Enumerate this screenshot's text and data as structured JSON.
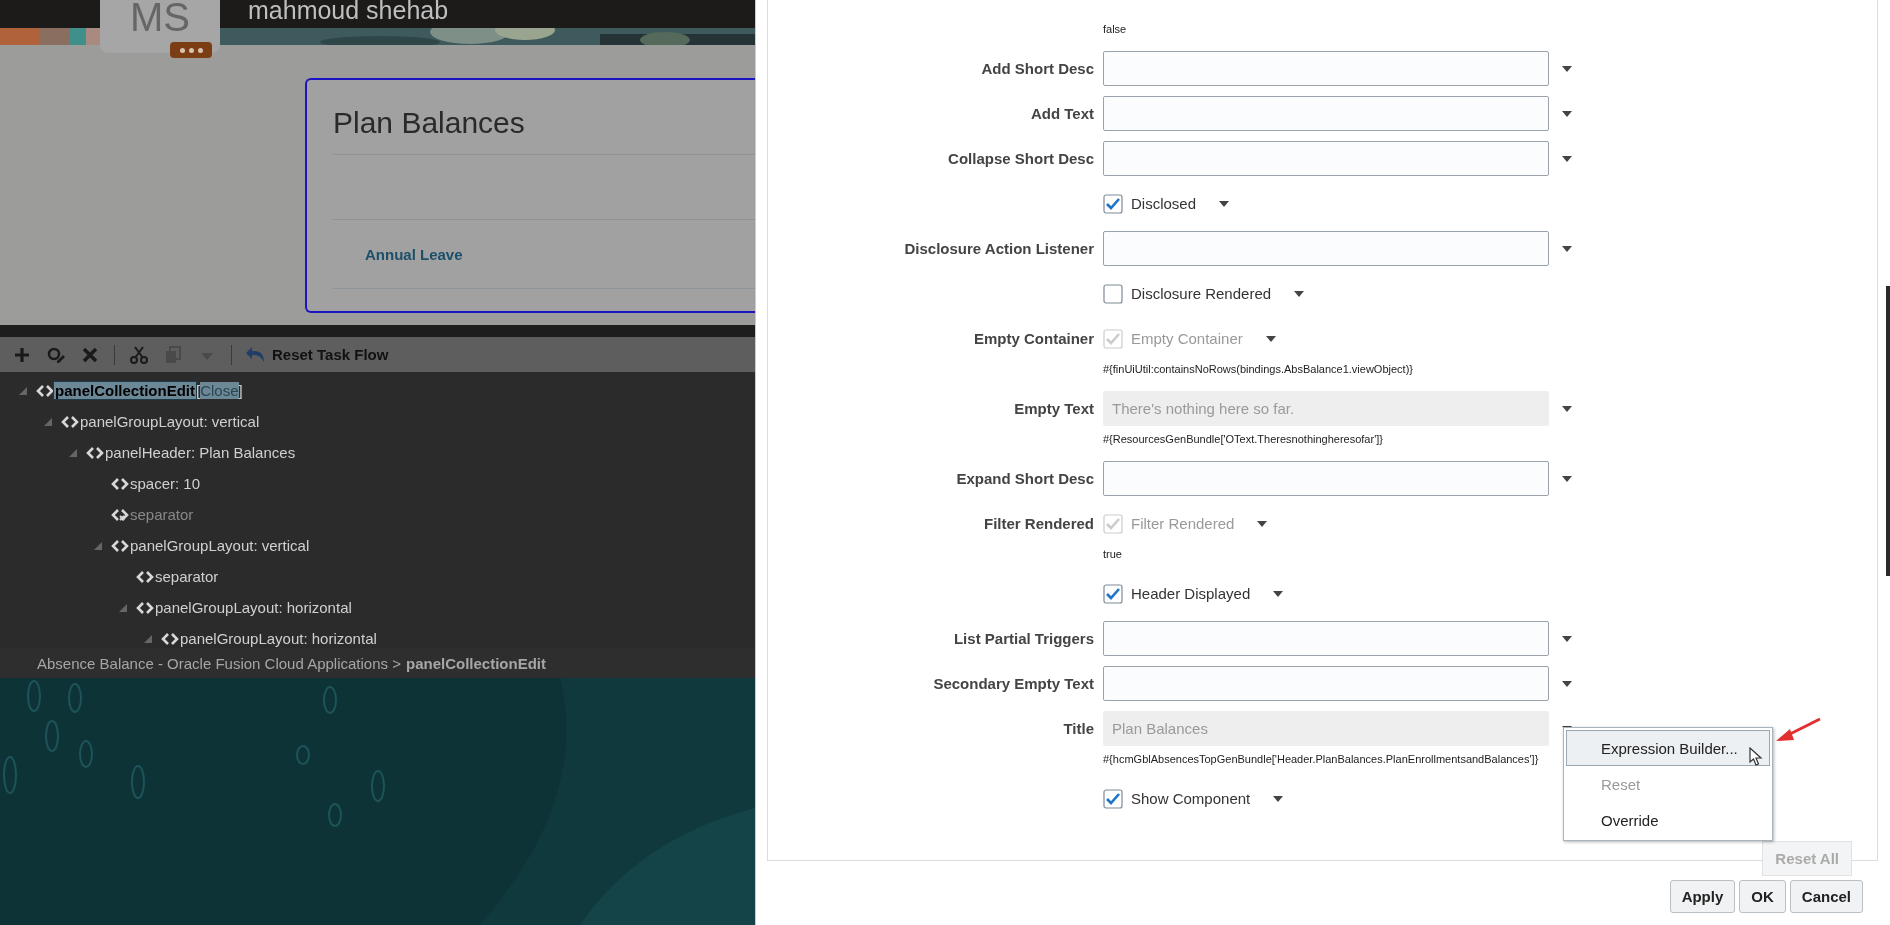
{
  "background_page": {
    "avatar_initials": "MS",
    "user_name": "mahmoud shehab",
    "card": {
      "title": "Plan Balances",
      "link": "Annual Leave"
    }
  },
  "toolbar": {
    "tools": [
      {
        "kind": "add",
        "disabled": false
      },
      {
        "kind": "edit",
        "disabled": false
      },
      {
        "kind": "delete",
        "disabled": false
      },
      {
        "kind": "cut",
        "disabled": false
      },
      {
        "kind": "copy",
        "disabled": true
      },
      {
        "kind": "dropdown",
        "disabled": true
      }
    ],
    "reset_button": "Reset Task Flow"
  },
  "tree": [
    {
      "label": "panelCollectionEdit",
      "action_open": "[",
      "action": "Close",
      "action_close": "]",
      "selected": true,
      "disabled": false,
      "expanded": true,
      "children": [
        {
          "label": "panelGroupLayout: vertical",
          "selected": false,
          "disabled": false,
          "expanded": true,
          "children": [
            {
              "label": "panelHeader: Plan Balances",
              "selected": false,
              "disabled": false,
              "expanded": true,
              "children": [
                {
                  "label": "spacer: 10",
                  "selected": false,
                  "disabled": false
                },
                {
                  "label": "separator",
                  "selected": false,
                  "disabled": true
                },
                {
                  "label": "panelGroupLayout: vertical",
                  "selected": false,
                  "disabled": false,
                  "expanded": true,
                  "children": [
                    {
                      "label": "separator",
                      "selected": false,
                      "disabled": false
                    },
                    {
                      "label": "panelGroupLayout: horizontal",
                      "selected": false,
                      "disabled": false,
                      "expanded": true,
                      "children": [
                        {
                          "label": "panelGroupLayout: horizontal",
                          "selected": false,
                          "disabled": false,
                          "expanded": true
                        }
                      ]
                    }
                  ]
                }
              ]
            }
          ]
        }
      ]
    }
  ],
  "breadcrumb": {
    "path": "Absence Balance - Oracle Fusion Cloud Applications",
    "separator": ">",
    "current": "panelCollectionEdit"
  },
  "properties": [
    {
      "kind": "expression",
      "text": "false"
    },
    {
      "kind": "text",
      "label": "Add Short Desc",
      "disabled": false
    },
    {
      "kind": "text",
      "label": "Add Text",
      "disabled": false
    },
    {
      "kind": "text",
      "label": "Collapse Short Desc",
      "disabled": false
    },
    {
      "kind": "checkbox",
      "checkbox_label": "Disclosed",
      "checked": true,
      "disabled": false
    },
    {
      "kind": "text",
      "label": "Disclosure Action Listener",
      "disabled": false
    },
    {
      "kind": "checkbox",
      "checkbox_label": "Disclosure Rendered",
      "checked": false,
      "disabled": false
    },
    {
      "kind": "checkbox",
      "label": "Empty Container",
      "checkbox_label": "Empty Container",
      "checked": true,
      "disabled": true
    },
    {
      "kind": "expression",
      "text": "#{finUiUtil:containsNoRows(bindings.AbsBalance1.viewObject)}"
    },
    {
      "kind": "text",
      "label": "Empty Text",
      "value": "There's nothing here so far.",
      "disabled": true
    },
    {
      "kind": "expression",
      "text": "#{ResourcesGenBundle['OText.Theresnothingheresofar']}"
    },
    {
      "kind": "text",
      "label": "Expand Short Desc",
      "disabled": false
    },
    {
      "kind": "checkbox",
      "label": "Filter Rendered",
      "checkbox_label": "Filter Rendered",
      "checked": true,
      "disabled": true
    },
    {
      "kind": "expression",
      "text": "true"
    },
    {
      "kind": "checkbox",
      "checkbox_label": "Header Displayed",
      "checked": true,
      "disabled": false
    },
    {
      "kind": "text",
      "label": "List Partial Triggers",
      "disabled": false
    },
    {
      "kind": "text",
      "label": "Secondary Empty Text",
      "disabled": false
    },
    {
      "kind": "text",
      "label": "Title",
      "value": "Plan Balances",
      "disabled": true
    },
    {
      "kind": "expression",
      "text": "#{hcmGblAbsencesTopGenBundle['Header.PlanBalances.PlanEnrollmentsandBalances']}"
    },
    {
      "kind": "checkbox",
      "checkbox_label": "Show Component",
      "checked": true,
      "disabled": false
    }
  ],
  "reset_all_button": "Reset All",
  "context_menu": [
    {
      "label": "Expression Builder...",
      "selected": true,
      "disabled": false
    },
    {
      "label": "Reset",
      "selected": false,
      "disabled": true
    },
    {
      "label": "Override",
      "selected": false,
      "disabled": false
    }
  ],
  "buttons": [
    "Apply",
    "OK",
    "Cancel"
  ]
}
